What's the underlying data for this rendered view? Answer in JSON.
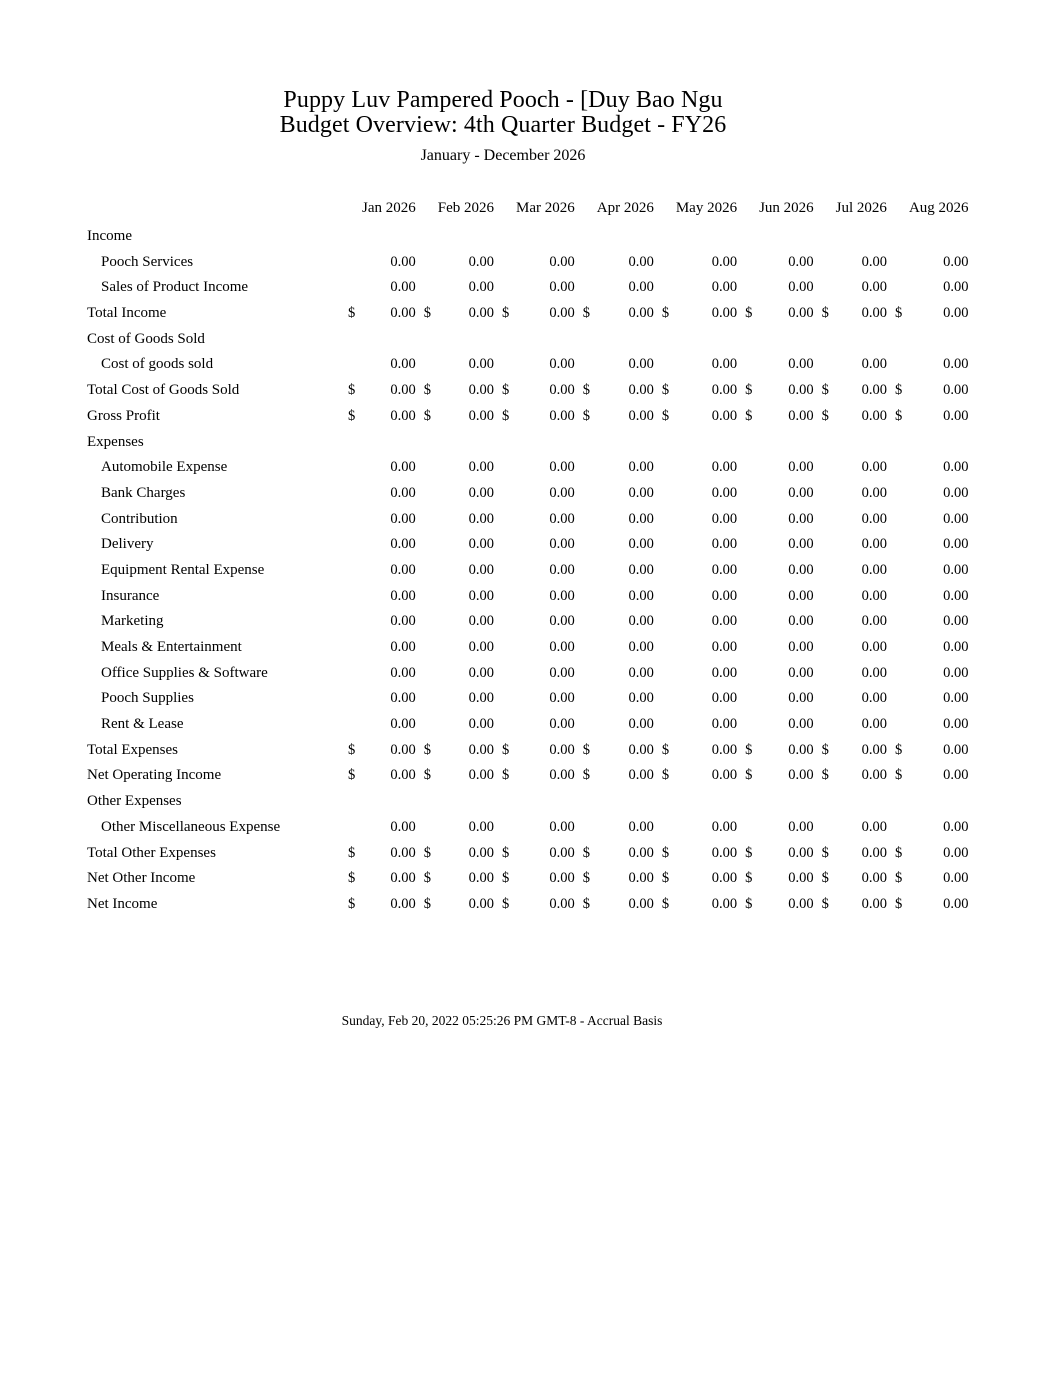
{
  "header": {
    "title_line1": "Puppy Luv Pampered Pooch - [Duy Bao Ngu",
    "title_line2": "Budget Overview: 4th Quarter Budget - FY26",
    "subtitle": "January - December 2026"
  },
  "table": {
    "currency_symbol": "$",
    "columns": [
      "Jan 2026",
      "Feb 2026",
      "Mar 2026",
      "Apr 2026",
      "May 2026",
      "Jun 2026",
      "Jul 2026",
      "Aug 2026"
    ],
    "rows": [
      {
        "label": "Income",
        "level": 0,
        "currency": false,
        "values": []
      },
      {
        "label": "Pooch Services",
        "level": 1,
        "currency": false,
        "values": [
          "0.00",
          "0.00",
          "0.00",
          "0.00",
          "0.00",
          "0.00",
          "0.00",
          "0.00"
        ]
      },
      {
        "label": "Sales of Product Income",
        "level": 1,
        "currency": false,
        "values": [
          "0.00",
          "0.00",
          "0.00",
          "0.00",
          "0.00",
          "0.00",
          "0.00",
          "0.00"
        ]
      },
      {
        "label": "Total Income",
        "level": 0,
        "currency": true,
        "values": [
          "0.00",
          "0.00",
          "0.00",
          "0.00",
          "0.00",
          "0.00",
          "0.00",
          "0.00"
        ]
      },
      {
        "label": "Cost of Goods Sold",
        "level": 0,
        "currency": false,
        "values": []
      },
      {
        "label": "Cost of goods sold",
        "level": 1,
        "currency": false,
        "values": [
          "0.00",
          "0.00",
          "0.00",
          "0.00",
          "0.00",
          "0.00",
          "0.00",
          "0.00"
        ]
      },
      {
        "label": "Total Cost of Goods Sold",
        "level": 0,
        "currency": true,
        "values": [
          "0.00",
          "0.00",
          "0.00",
          "0.00",
          "0.00",
          "0.00",
          "0.00",
          "0.00"
        ]
      },
      {
        "label": "Gross Profit",
        "level": 0,
        "currency": true,
        "values": [
          "0.00",
          "0.00",
          "0.00",
          "0.00",
          "0.00",
          "0.00",
          "0.00",
          "0.00"
        ]
      },
      {
        "label": "Expenses",
        "level": 0,
        "currency": false,
        "values": []
      },
      {
        "label": "Automobile Expense",
        "level": 1,
        "currency": false,
        "values": [
          "0.00",
          "0.00",
          "0.00",
          "0.00",
          "0.00",
          "0.00",
          "0.00",
          "0.00"
        ]
      },
      {
        "label": "Bank Charges",
        "level": 1,
        "currency": false,
        "values": [
          "0.00",
          "0.00",
          "0.00",
          "0.00",
          "0.00",
          "0.00",
          "0.00",
          "0.00"
        ]
      },
      {
        "label": "Contribution",
        "level": 1,
        "currency": false,
        "values": [
          "0.00",
          "0.00",
          "0.00",
          "0.00",
          "0.00",
          "0.00",
          "0.00",
          "0.00"
        ]
      },
      {
        "label": "Delivery",
        "level": 1,
        "currency": false,
        "values": [
          "0.00",
          "0.00",
          "0.00",
          "0.00",
          "0.00",
          "0.00",
          "0.00",
          "0.00"
        ]
      },
      {
        "label": "Equipment Rental Expense",
        "level": 1,
        "currency": false,
        "values": [
          "0.00",
          "0.00",
          "0.00",
          "0.00",
          "0.00",
          "0.00",
          "0.00",
          "0.00"
        ]
      },
      {
        "label": "Insurance",
        "level": 1,
        "currency": false,
        "values": [
          "0.00",
          "0.00",
          "0.00",
          "0.00",
          "0.00",
          "0.00",
          "0.00",
          "0.00"
        ]
      },
      {
        "label": "Marketing",
        "level": 1,
        "currency": false,
        "values": [
          "0.00",
          "0.00",
          "0.00",
          "0.00",
          "0.00",
          "0.00",
          "0.00",
          "0.00"
        ]
      },
      {
        "label": "Meals & Entertainment",
        "level": 1,
        "currency": false,
        "values": [
          "0.00",
          "0.00",
          "0.00",
          "0.00",
          "0.00",
          "0.00",
          "0.00",
          "0.00"
        ]
      },
      {
        "label": "Office Supplies & Software",
        "level": 1,
        "currency": false,
        "values": [
          "0.00",
          "0.00",
          "0.00",
          "0.00",
          "0.00",
          "0.00",
          "0.00",
          "0.00"
        ]
      },
      {
        "label": "Pooch Supplies",
        "level": 1,
        "currency": false,
        "values": [
          "0.00",
          "0.00",
          "0.00",
          "0.00",
          "0.00",
          "0.00",
          "0.00",
          "0.00"
        ]
      },
      {
        "label": "Rent & Lease",
        "level": 1,
        "currency": false,
        "values": [
          "0.00",
          "0.00",
          "0.00",
          "0.00",
          "0.00",
          "0.00",
          "0.00",
          "0.00"
        ]
      },
      {
        "label": "Total Expenses",
        "level": 0,
        "currency": true,
        "values": [
          "0.00",
          "0.00",
          "0.00",
          "0.00",
          "0.00",
          "0.00",
          "0.00",
          "0.00"
        ]
      },
      {
        "label": "Net Operating Income",
        "level": 0,
        "currency": true,
        "values": [
          "0.00",
          "0.00",
          "0.00",
          "0.00",
          "0.00",
          "0.00",
          "0.00",
          "0.00"
        ]
      },
      {
        "label": "Other Expenses",
        "level": 0,
        "currency": false,
        "values": []
      },
      {
        "label": "Other Miscellaneous Expense",
        "level": 1,
        "currency": false,
        "values": [
          "0.00",
          "0.00",
          "0.00",
          "0.00",
          "0.00",
          "0.00",
          "0.00",
          "0.00"
        ]
      },
      {
        "label": "Total Other Expenses",
        "level": 0,
        "currency": true,
        "values": [
          "0.00",
          "0.00",
          "0.00",
          "0.00",
          "0.00",
          "0.00",
          "0.00",
          "0.00"
        ]
      },
      {
        "label": "Net Other Income",
        "level": 0,
        "currency": true,
        "values": [
          "0.00",
          "0.00",
          "0.00",
          "0.00",
          "0.00",
          "0.00",
          "0.00",
          "0.00"
        ]
      },
      {
        "label": "Net Income",
        "level": 0,
        "currency": true,
        "values": [
          "0.00",
          "0.00",
          "0.00",
          "0.00",
          "0.00",
          "0.00",
          "0.00",
          "0.00"
        ]
      }
    ]
  },
  "footer": {
    "text": "Sunday, Feb 20, 2022 05:25:26 PM GMT-8 - Accrual Basis"
  }
}
